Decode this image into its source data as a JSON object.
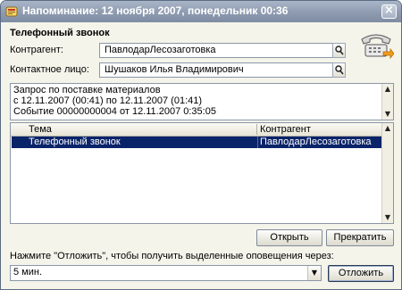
{
  "window": {
    "title": "Напоминание: 12 ноября 2007, понедельник 00:36",
    "close_glyph": "×",
    "title_icon": "app-icon",
    "phone_icon": "phone-icon"
  },
  "form": {
    "heading": "Телефонный звонок",
    "counterparty_label": "Контрагент:",
    "counterparty_value": "ПавлодарЛесозаготовка",
    "contact_label": "Контактное лицо:",
    "contact_value": "Шушаков Илья Владимирович"
  },
  "memo": {
    "lines": [
      "Запрос по поставке материалов",
      "с 12.11.2007 (00:41) по 12.11.2007 (01:41)",
      "Событие 00000000004 от 12.11.2007 0:35:05"
    ]
  },
  "grid": {
    "columns": [
      "Тема",
      "Контрагент"
    ],
    "rows": [
      {
        "topic": "Телефонный звонок",
        "counterparty": "ПавлодарЛесозаготовка",
        "selected": true
      }
    ]
  },
  "buttons": {
    "open": "Открыть",
    "stop": "Прекратить",
    "snooze": "Отложить"
  },
  "snooze": {
    "hint": "Нажмите \"Отложить\", чтобы получить выделенные оповещения через:",
    "selected": "5 мин."
  },
  "colors": {
    "selection": "#0a246a",
    "titlebar": "#8e9bb0",
    "window_bg": "#f5f4ea"
  }
}
